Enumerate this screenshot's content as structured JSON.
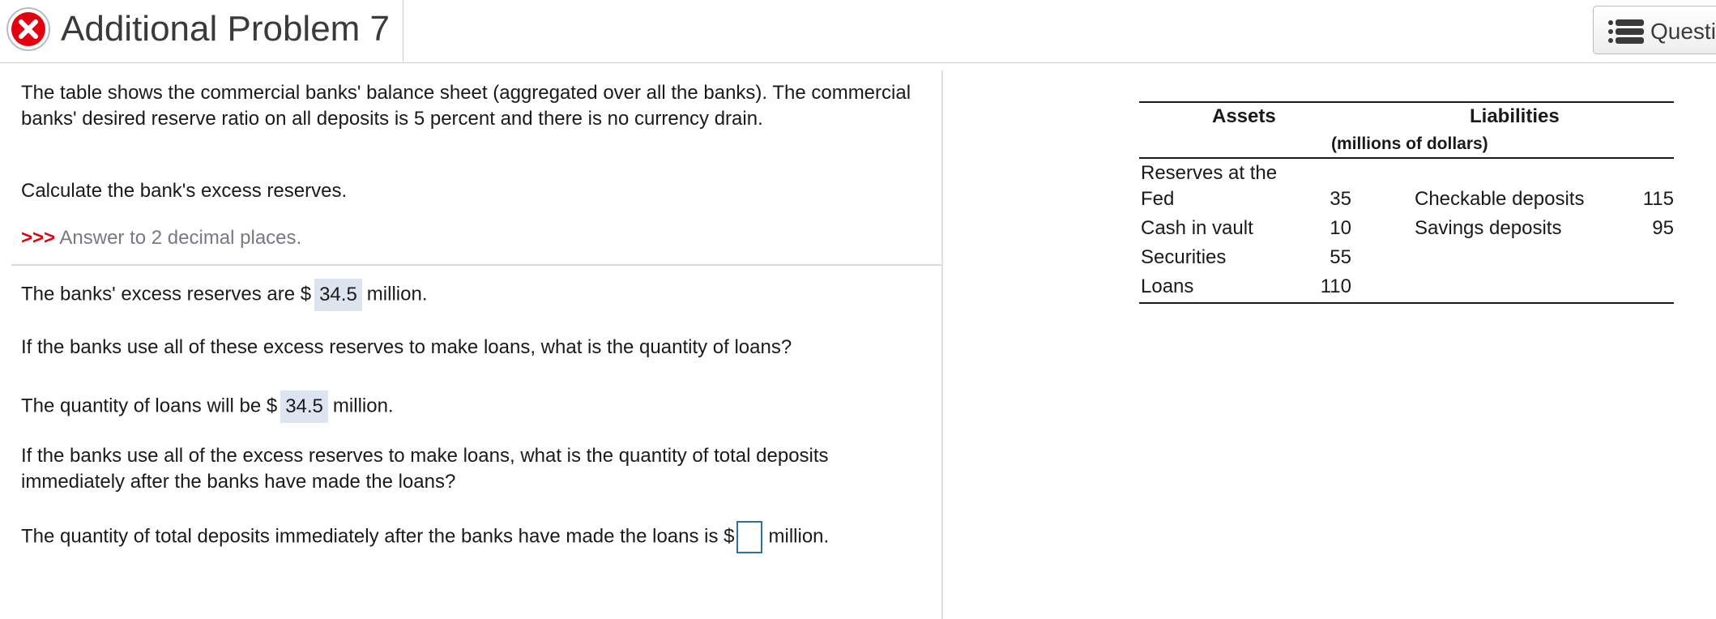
{
  "header": {
    "title": "Additional Problem 7",
    "status_icon": "incorrect-x-icon",
    "question_button_label": "Questi",
    "question_button_icon": "list-icon"
  },
  "problem": {
    "intro": "The table shows the commercial banks' balance sheet (aggregated over all the banks). The commercial banks' desired reserve ratio on all deposits is 5 percent and there is no currency drain.",
    "question1": "Calculate the bank's excess reserves.",
    "hint_arrows": ">>>",
    "hint_text": " Answer to 2 decimal places."
  },
  "answers": {
    "excess_prefix": "The banks' excess reserves are $",
    "excess_value": "34.5",
    "excess_suffix": "million.",
    "question2": "If the banks use all of these excess reserves to make loans, what is the quantity of loans?",
    "loans_prefix": "The quantity of loans will be $",
    "loans_value": "34.5",
    "loans_suffix": "million.",
    "question3_line1": "If the banks use all of the excess reserves to make loans, what is the quantity of total deposits",
    "question3_line2": "immediately after the banks have made the loans?",
    "deposits_prefix": "The quantity of total deposits immediately after the banks have made the loans is $",
    "deposits_value": "",
    "deposits_suffix": "million."
  },
  "balance_sheet": {
    "assets_header": "Assets",
    "liabilities_header": "Liabilities",
    "units": "(millions of dollars)",
    "assets": [
      {
        "label_line1": "Reserves at the",
        "label_line2": "Fed",
        "value": "35"
      },
      {
        "label": "Cash in vault",
        "value": "10"
      },
      {
        "label": "Securities",
        "value": "55"
      },
      {
        "label": "Loans",
        "value": "110"
      }
    ],
    "liabilities": [
      {
        "label": "Checkable deposits",
        "value": "115"
      },
      {
        "label": "Savings deposits",
        "value": "95"
      }
    ]
  },
  "colors": {
    "incorrect_red": "#e3000f",
    "answer_bg": "#dbe4ef",
    "input_border": "#2f6fa3"
  }
}
